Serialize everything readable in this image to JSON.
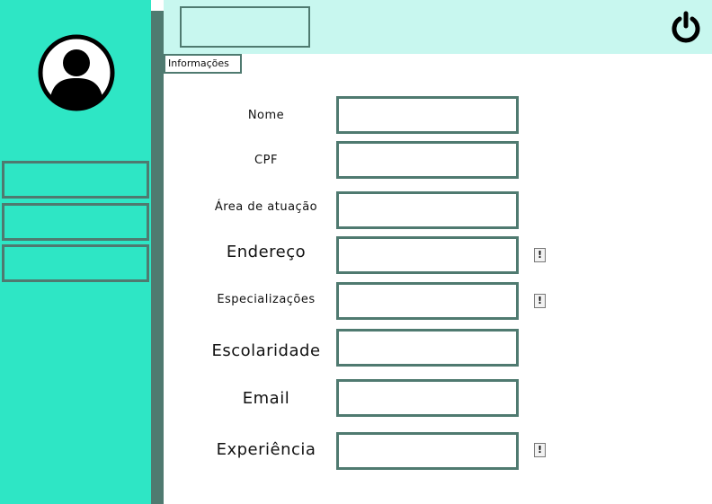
{
  "info_tab": {
    "label": "Informações"
  },
  "form": {
    "fields": [
      {
        "label": "Nome",
        "value": "",
        "placeholder": ""
      },
      {
        "label": "CPF",
        "value": "",
        "placeholder": ""
      },
      {
        "label": "Área de atuação",
        "value": "",
        "placeholder": ""
      },
      {
        "label": "Endereço",
        "value": "",
        "placeholder": ""
      },
      {
        "label": "Especializações",
        "value": "",
        "placeholder": ""
      },
      {
        "label": "Escolaridade",
        "value": "",
        "placeholder": ""
      },
      {
        "label": "Email",
        "value": "",
        "placeholder": ""
      },
      {
        "label": "Experiência",
        "value": "",
        "placeholder": ""
      }
    ],
    "alert_symbol": "!"
  },
  "icons": {
    "avatar": "user-avatar-icon",
    "power": "power-icon"
  },
  "colors": {
    "sidebar": "#2ee6c5",
    "header": "#c8f7ef",
    "border": "#4f7a70"
  }
}
